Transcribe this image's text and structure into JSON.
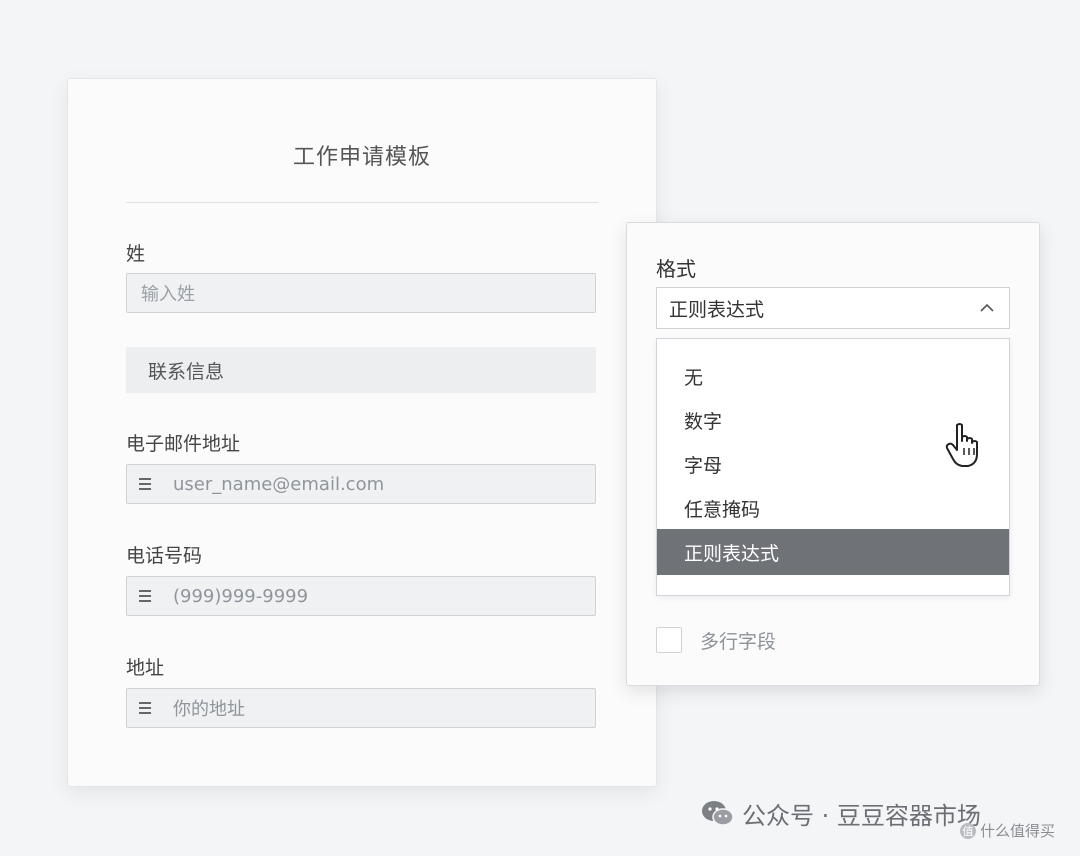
{
  "form": {
    "title": "工作申请模板",
    "fields": {
      "last_name": {
        "label": "姓",
        "placeholder": "输入姓"
      },
      "section": {
        "label": "联系信息"
      },
      "email": {
        "label": "电子邮件地址",
        "placeholder": "user_name@email.com"
      },
      "phone": {
        "label": "电话号码",
        "placeholder": "(999)999-9999"
      },
      "address": {
        "label": "地址",
        "placeholder": "你的地址"
      }
    }
  },
  "format_panel": {
    "label": "格式",
    "selected_value": "正则表达式",
    "options": [
      "无",
      "数字",
      "字母",
      "任意掩码",
      "正则表达式"
    ],
    "selected_index": 4,
    "multiline_label": "多行字段",
    "multiline_checked": false
  },
  "watermark": {
    "text": "公众号 · 豆豆容器市场",
    "secondary": "什么值得买",
    "badge_char": "值"
  },
  "colors": {
    "selected_option_bg": "#6f7378",
    "background": "#f4f5f7"
  }
}
